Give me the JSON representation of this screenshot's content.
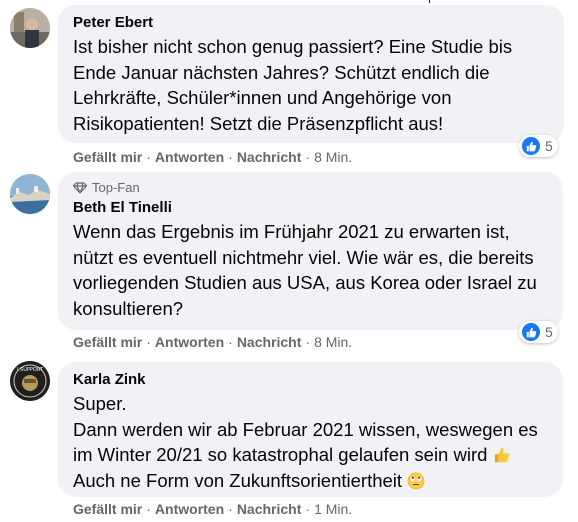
{
  "comments": [
    {
      "author": "Peter Ebert",
      "badge": "",
      "text_lines": [
        "Ist bisher nicht schon genug passiert? Eine Studie bis",
        "Ende Januar nächsten Jahres? Schützt endlich die",
        "Lehrkräfte, Schüler*innen und Angehörige von",
        "Risikopatienten! Setzt die Präsenzpflicht aus!"
      ],
      "reaction_count": "5",
      "actions": {
        "like": "Gefällt mir",
        "reply": "Antworten",
        "message": "Nachricht",
        "time": "8 Min."
      }
    },
    {
      "author": "Beth El Tinelli",
      "badge": "Top-Fan",
      "text_lines": [
        "Wenn das Ergebnis im Frühjahr 2021 zu erwarten ist,",
        "nützt es eventuell nichtmehr viel. Wie wär es, die bereits",
        "vorliegenden Studien aus USA, aus Korea oder Israel zu",
        "konsultieren?"
      ],
      "reaction_count": "5",
      "actions": {
        "like": "Gefällt mir",
        "reply": "Antworten",
        "message": "Nachricht",
        "time": "8 Min."
      }
    },
    {
      "author": "Karla Zink",
      "badge": "",
      "text_lines": [
        "Super.",
        "Dann werden wir ab Februar 2021 wissen, weswegen es",
        "im Winter 20/21 so katastrophal gelaufen sein wird",
        "Auch ne Form von Zukunftsorientiertheit"
      ],
      "avatar_text": "I SUPPORT",
      "emojis": [
        "thumbs-up-emoji",
        "rolling-eyes-emoji"
      ],
      "actions": {
        "like": "Gefällt mir",
        "reply": "Antworten",
        "message": "Nachricht",
        "time": "1 Min."
      }
    }
  ],
  "colors": {
    "bubble": "#f0f2f5",
    "like_blue": "#1877f2",
    "meta_gray": "#65676b",
    "text": "#050505"
  },
  "icons": {
    "reaction": "like-icon",
    "top_fan": "diamond-icon"
  }
}
